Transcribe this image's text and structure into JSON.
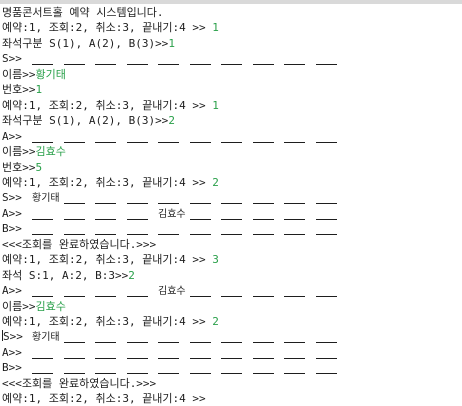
{
  "console": {
    "lines": [
      {
        "prefix": "명품콘서트홀 예약 시스템입니다."
      },
      {
        "prefix": "예약:1, 조회:2, 취소:3, 끝내기:4 >> ",
        "input": "1"
      },
      {
        "prefix": "좌석구분 S(1), A(2), B(3)>>",
        "input": "1"
      },
      {
        "prefix": "S>> ",
        "seats": [
          "",
          "",
          "",
          "",
          "",
          "",
          "",
          "",
          "",
          ""
        ]
      },
      {
        "prefix": "이름>>",
        "input": "황기태"
      },
      {
        "prefix": "번호>>",
        "input": "1"
      },
      {
        "prefix": "예약:1, 조회:2, 취소:3, 끝내기:4 >> ",
        "input": "1"
      },
      {
        "prefix": "좌석구분 S(1), A(2), B(3)>>",
        "input": "2"
      },
      {
        "prefix": "A>> ",
        "seats": [
          "",
          "",
          "",
          "",
          "",
          "",
          "",
          "",
          "",
          ""
        ]
      },
      {
        "prefix": "이름>>",
        "input": "김효수"
      },
      {
        "prefix": "번호>>",
        "input": "5"
      },
      {
        "prefix": "예약:1, 조회:2, 취소:3, 끝내기:4 >> ",
        "input": "2"
      },
      {
        "prefix": "S>> ",
        "seats": [
          "황기태",
          "",
          "",
          "",
          "",
          "",
          "",
          "",
          "",
          ""
        ]
      },
      {
        "prefix": "A>> ",
        "seats": [
          "",
          "",
          "",
          "",
          "김효수",
          "",
          "",
          "",
          "",
          ""
        ]
      },
      {
        "prefix": "B>> ",
        "seats": [
          "",
          "",
          "",
          "",
          "",
          "",
          "",
          "",
          "",
          ""
        ]
      },
      {
        "prefix": "<<<조회를 완료하였습니다.>>>"
      },
      {
        "prefix": "예약:1, 조회:2, 취소:3, 끝내기:4 >> ",
        "input": "3"
      },
      {
        "prefix": "좌석 S:1, A:2, B:3>>",
        "input": "2"
      },
      {
        "prefix": "A>> ",
        "seats": [
          "",
          "",
          "",
          "",
          "김효수",
          "",
          "",
          "",
          "",
          ""
        ]
      },
      {
        "prefix": "이름>>",
        "input": "김효수"
      },
      {
        "prefix": "예약:1, 조회:2, 취소:3, 끝내기:4 >> ",
        "input": "2"
      },
      {
        "prefix": "S>> ",
        "seats": [
          "황기태",
          "",
          "",
          "",
          "",
          "",
          "",
          "",
          "",
          ""
        ],
        "cursor": true
      },
      {
        "prefix": "A>> ",
        "seats": [
          "",
          "",
          "",
          "",
          "",
          "",
          "",
          "",
          "",
          ""
        ]
      },
      {
        "prefix": "B>> ",
        "seats": [
          "",
          "",
          "",
          "",
          "",
          "",
          "",
          "",
          "",
          ""
        ]
      },
      {
        "prefix": "<<<조회를 완료하였습니다.>>>"
      },
      {
        "prefix": "예약:1, 조회:2, 취소:3, 끝내기:4 >> "
      }
    ]
  },
  "colors": {
    "text": "#1e1e1e",
    "user_input": "#2aa04a"
  }
}
